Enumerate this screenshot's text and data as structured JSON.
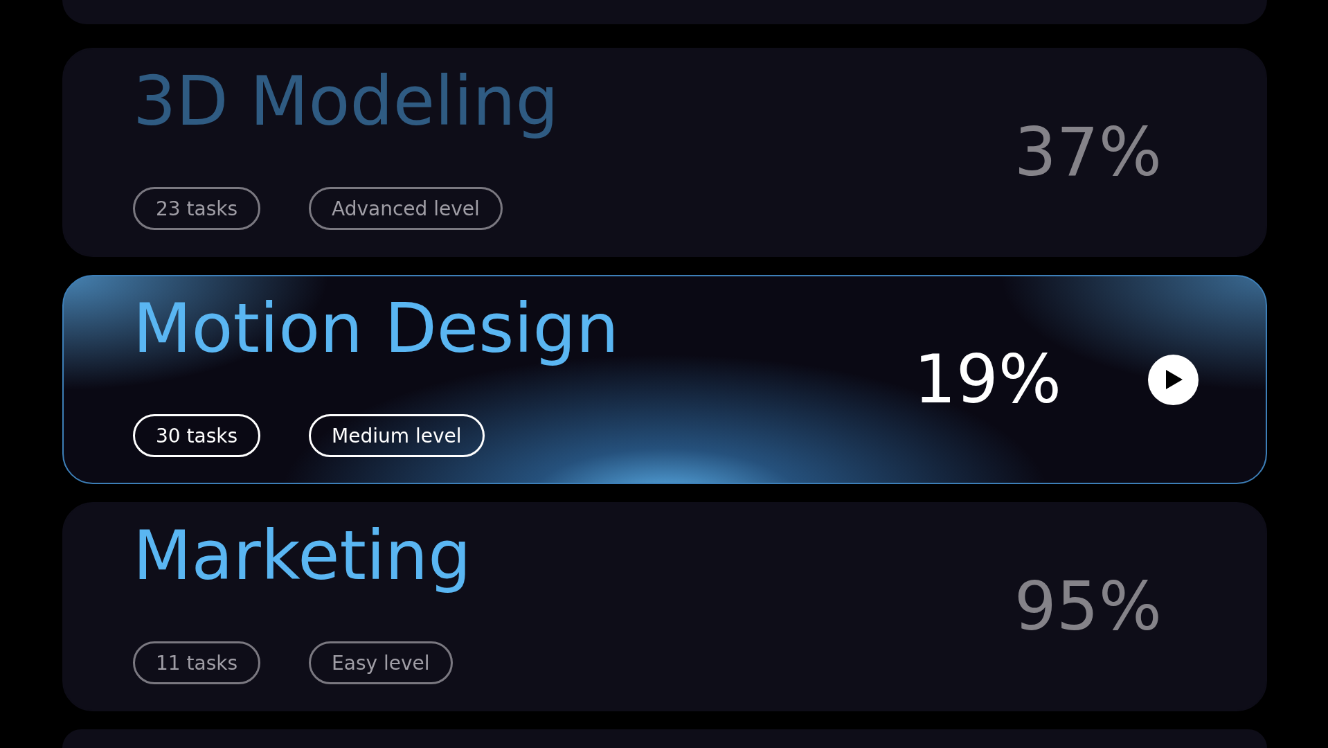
{
  "courses": [
    {
      "title": "3D Modeling",
      "faded": true,
      "tasks": "23 tasks",
      "level": "Advanced level",
      "progress": "37%",
      "selected": false
    },
    {
      "title": "Motion Design",
      "faded": false,
      "tasks": "30 tasks",
      "level": "Medium level",
      "progress": "19%",
      "selected": true
    },
    {
      "title": "Marketing",
      "faded": false,
      "tasks": "11 tasks",
      "level": "Easy level",
      "progress": "95%",
      "selected": false
    }
  ]
}
